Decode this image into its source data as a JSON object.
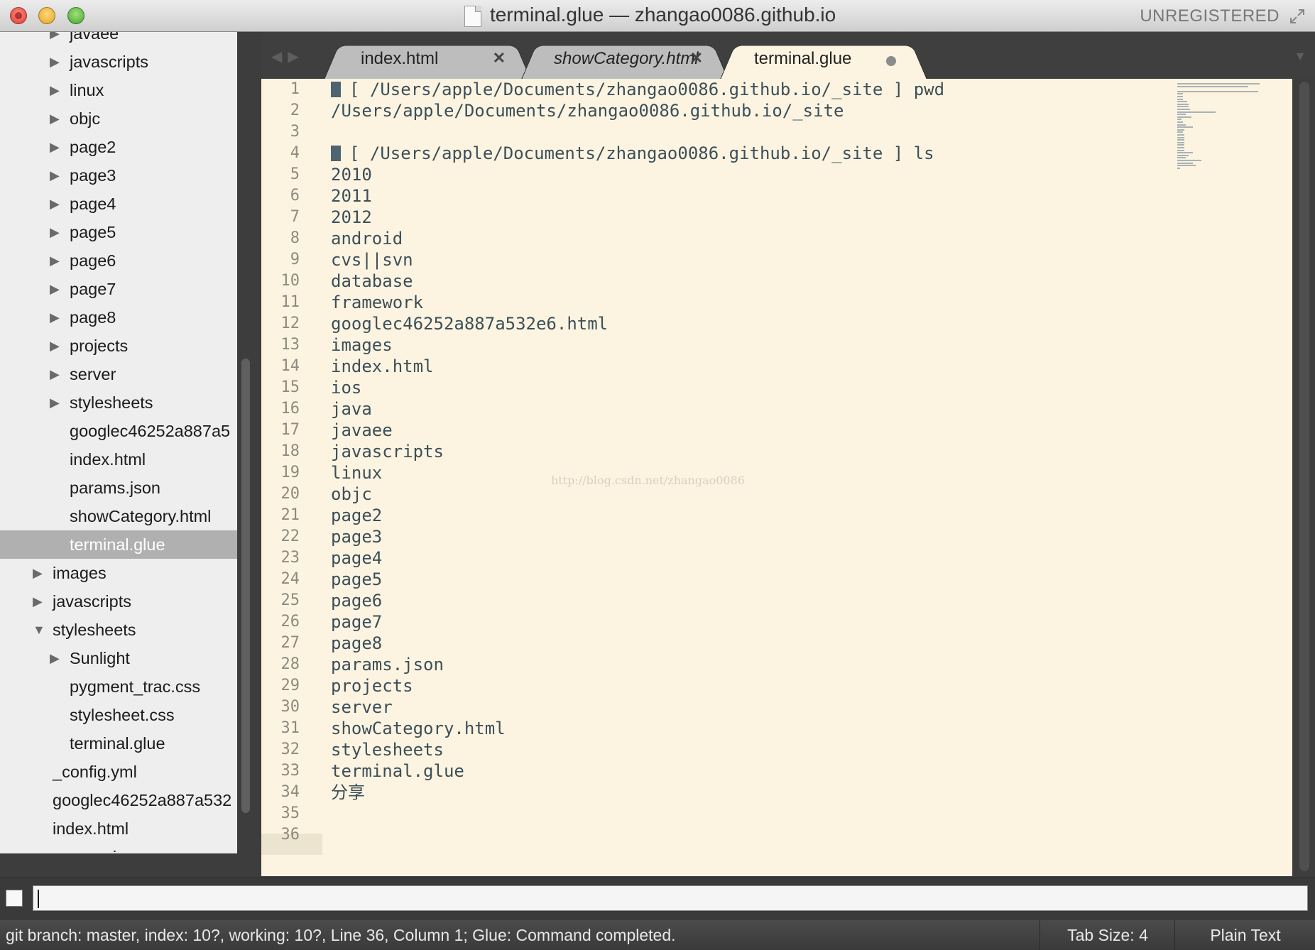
{
  "window": {
    "title": "terminal.glue — zhangao0086.github.io",
    "registration": "UNREGISTERED"
  },
  "sidebar": {
    "items": [
      {
        "label": "javaee",
        "twisty": "collapsed"
      },
      {
        "label": "javascripts",
        "twisty": "collapsed"
      },
      {
        "label": "linux",
        "twisty": "collapsed"
      },
      {
        "label": "objc",
        "twisty": "collapsed"
      },
      {
        "label": "page2",
        "twisty": "collapsed"
      },
      {
        "label": "page3",
        "twisty": "collapsed"
      },
      {
        "label": "page4",
        "twisty": "collapsed"
      },
      {
        "label": "page5",
        "twisty": "collapsed"
      },
      {
        "label": "page6",
        "twisty": "collapsed"
      },
      {
        "label": "page7",
        "twisty": "collapsed"
      },
      {
        "label": "page8",
        "twisty": "collapsed"
      },
      {
        "label": "projects",
        "twisty": "collapsed"
      },
      {
        "label": "server",
        "twisty": "collapsed"
      },
      {
        "label": "stylesheets",
        "twisty": "collapsed"
      },
      {
        "label": "googlec46252a887a5",
        "twisty": "none"
      },
      {
        "label": "index.html",
        "twisty": "none"
      },
      {
        "label": "params.json",
        "twisty": "none"
      },
      {
        "label": "showCategory.html",
        "twisty": "none"
      },
      {
        "label": "terminal.glue",
        "twisty": "none",
        "selected": true
      },
      {
        "label": "images",
        "twisty": "collapsed"
      },
      {
        "label": "javascripts",
        "twisty": "collapsed"
      },
      {
        "label": "stylesheets",
        "twisty": "expanded"
      },
      {
        "label": "Sunlight",
        "twisty": "collapsed"
      },
      {
        "label": "pygment_trac.css",
        "twisty": "none"
      },
      {
        "label": "stylesheet.css",
        "twisty": "none"
      },
      {
        "label": "terminal.glue",
        "twisty": "none"
      },
      {
        "label": "_config.yml",
        "twisty": "none"
      },
      {
        "label": "googlec46252a887a532",
        "twisty": "none"
      },
      {
        "label": "index.html",
        "twisty": "none"
      },
      {
        "label": "params.json",
        "twisty": "none"
      }
    ]
  },
  "tabs": [
    {
      "label": "index.html",
      "active": false,
      "italic": false,
      "dirty": false
    },
    {
      "label": "showCategory.html",
      "active": false,
      "italic": true,
      "dirty": false
    },
    {
      "label": "terminal.glue",
      "active": true,
      "italic": false,
      "dirty": true
    }
  ],
  "editor": {
    "current_line": 36,
    "lines": [
      {
        "text": "[ /Users/apple/Documents/zhangao0086.github.io/_site ] pwd",
        "prompt": true
      },
      {
        "text": "/Users/apple/Documents/zhangao0086.github.io/_site"
      },
      {
        "text": ""
      },
      {
        "text": "[ /Users/apple/Documents/zhangao0086.github.io/_site ] ls",
        "prompt": true
      },
      {
        "text": "2010"
      },
      {
        "text": "2011"
      },
      {
        "text": "2012"
      },
      {
        "text": "android"
      },
      {
        "text": "cvs||svn"
      },
      {
        "text": "database"
      },
      {
        "text": "framework"
      },
      {
        "text": "googlec46252a887a532e6.html"
      },
      {
        "text": "images"
      },
      {
        "text": "index.html"
      },
      {
        "text": "ios"
      },
      {
        "text": "java"
      },
      {
        "text": "javaee"
      },
      {
        "text": "javascripts"
      },
      {
        "text": "linux"
      },
      {
        "text": "objc"
      },
      {
        "text": "page2"
      },
      {
        "text": "page3"
      },
      {
        "text": "page4"
      },
      {
        "text": "page5"
      },
      {
        "text": "page6"
      },
      {
        "text": "page7"
      },
      {
        "text": "page8"
      },
      {
        "text": "params.json"
      },
      {
        "text": "projects"
      },
      {
        "text": "server"
      },
      {
        "text": "showCategory.html"
      },
      {
        "text": "stylesheets"
      },
      {
        "text": "terminal.glue"
      },
      {
        "text": "分享"
      },
      {
        "text": ""
      },
      {
        "text": ""
      }
    ],
    "watermark": "http://blog.csdn.net/zhangao0086"
  },
  "command": {
    "value": ""
  },
  "status": {
    "message": "git branch: master, index: 10?, working: 10?, Line 36, Column 1; Glue: Command completed.",
    "tab_size": "Tab Size: 4",
    "syntax": "Plain Text"
  },
  "colors": {
    "editor_bg": "#fcf4e0",
    "text": "#3c4f5a",
    "chrome": "#3d3d3d"
  }
}
